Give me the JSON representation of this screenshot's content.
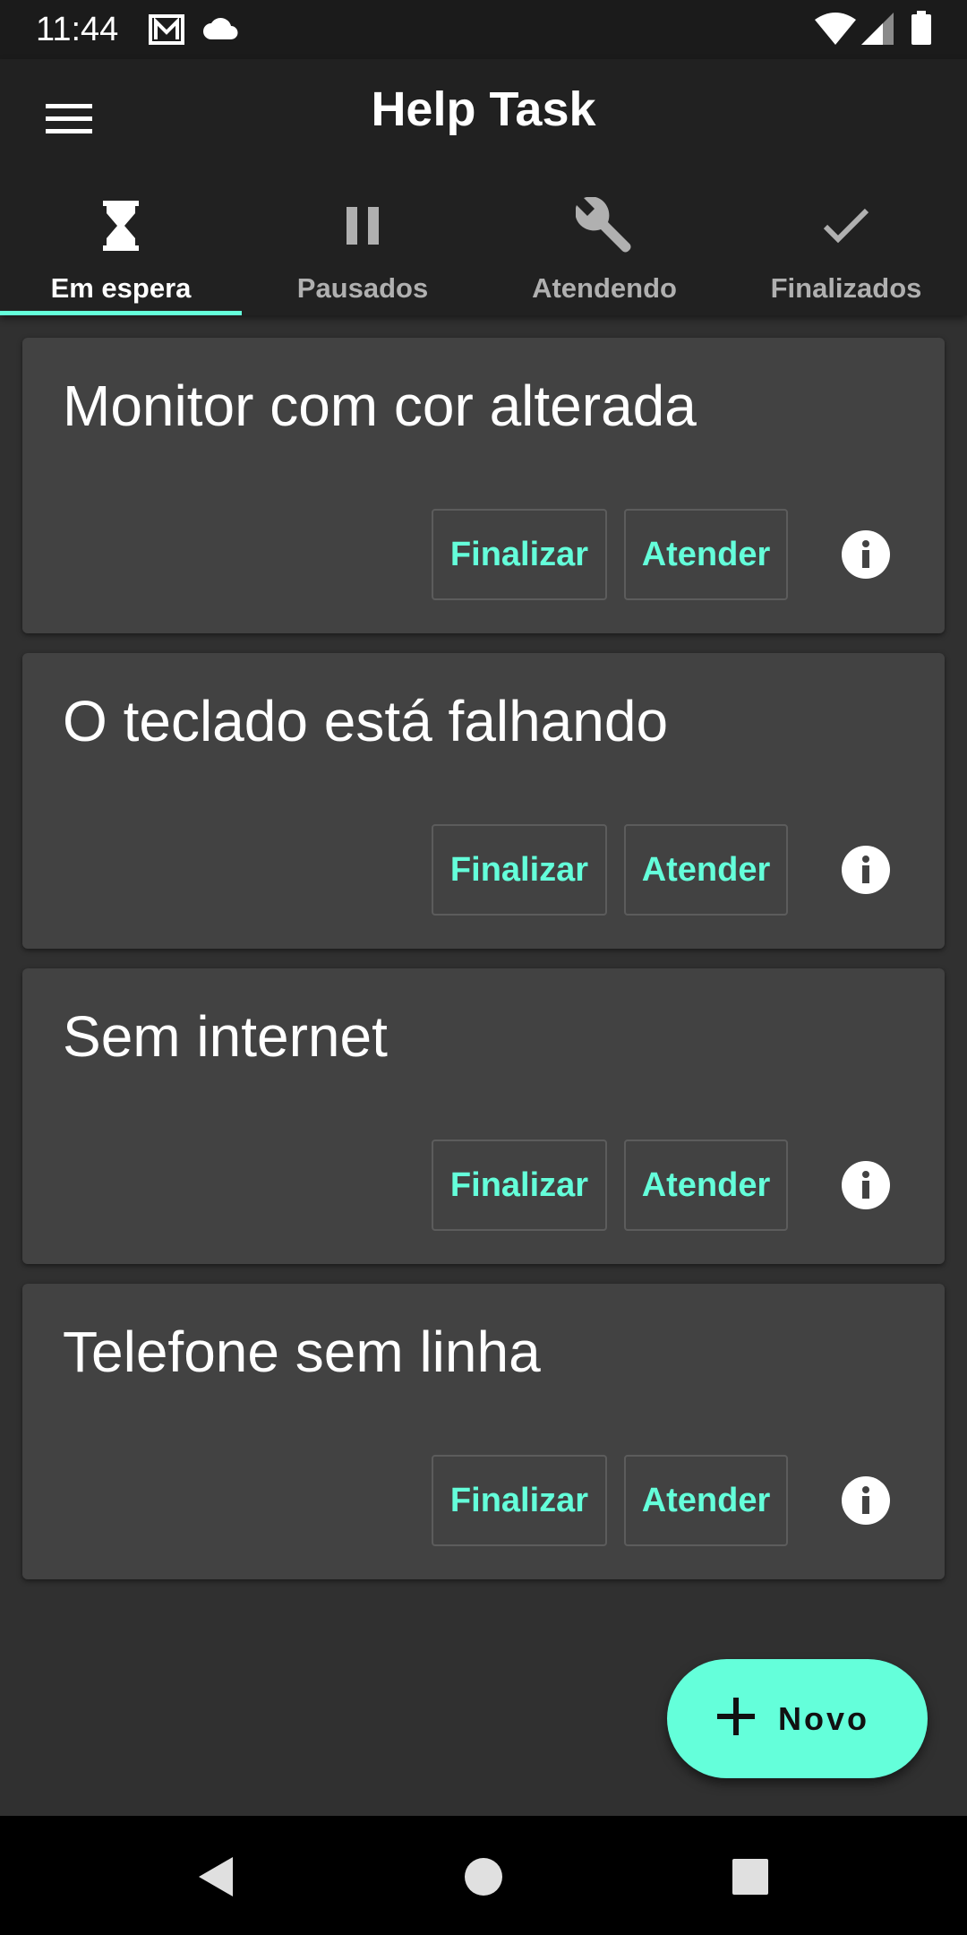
{
  "status_bar": {
    "time": "11:44",
    "icons": [
      "gmail-icon",
      "cloud-icon",
      "wifi-icon",
      "signal-icon",
      "battery-icon"
    ]
  },
  "app_bar": {
    "title": "Help Task",
    "menu_icon": "menu-icon"
  },
  "tabs": [
    {
      "label": "Em espera",
      "icon": "hourglass-icon",
      "active": true
    },
    {
      "label": "Pausados",
      "icon": "pause-icon",
      "active": false
    },
    {
      "label": "Atendendo",
      "icon": "wrench-icon",
      "active": false
    },
    {
      "label": "Finalizados",
      "icon": "check-icon",
      "active": false
    }
  ],
  "tickets": [
    {
      "title": "Monitor com cor alterada",
      "finalize_label": "Finalizar",
      "attend_label": "Atender",
      "info_icon": "info-icon"
    },
    {
      "title": "O teclado está falhando",
      "finalize_label": "Finalizar",
      "attend_label": "Atender",
      "info_icon": "info-icon"
    },
    {
      "title": "Sem internet",
      "finalize_label": "Finalizar",
      "attend_label": "Atender",
      "info_icon": "info-icon"
    },
    {
      "title": "Telefone sem linha",
      "finalize_label": "Finalizar",
      "attend_label": "Atender",
      "info_icon": "info-icon"
    }
  ],
  "fab": {
    "label": "Novo",
    "icon": "plus-icon"
  },
  "colors": {
    "accent": "#64ffda",
    "app_bar": "#212121",
    "background": "#303030",
    "card": "#424242"
  }
}
